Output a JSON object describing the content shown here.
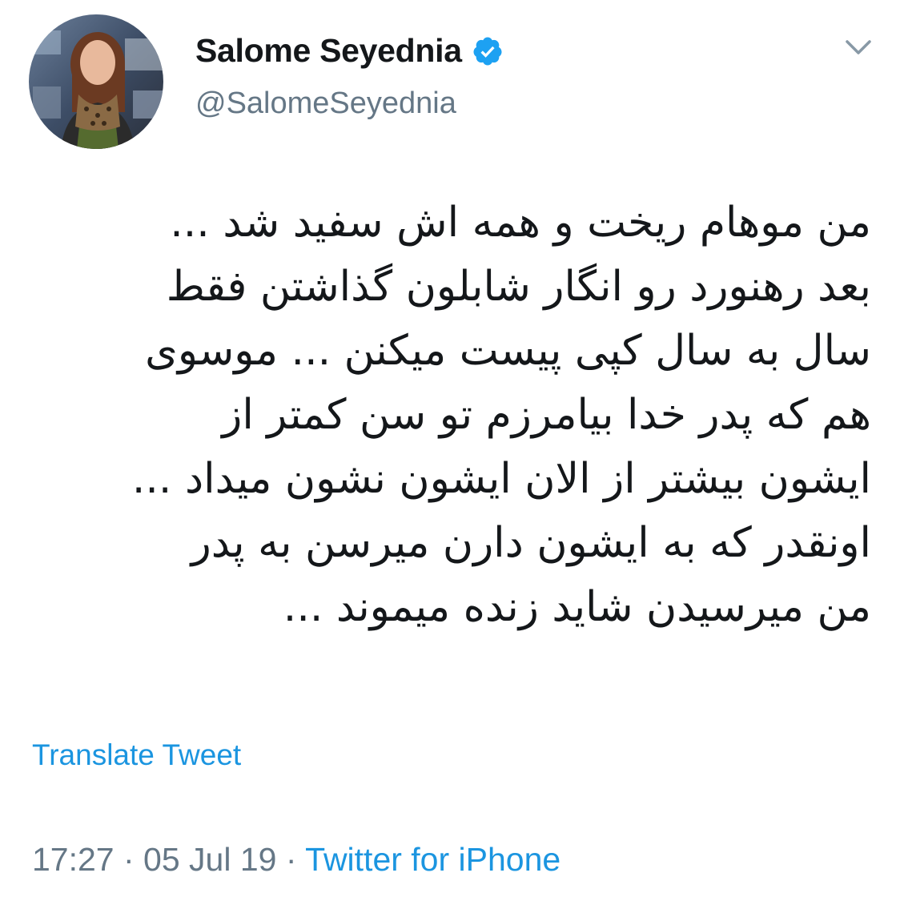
{
  "user": {
    "display_name": "Salome Seyednia",
    "handle": "@SalomeSeyednia",
    "verified": true,
    "avatar_icon": "profile-photo"
  },
  "tweet": {
    "lines": [
      "من موهام ریخت و همه اش سفید شد ...",
      "بعد رهنورد رو انگار شابلون گذاشتن فقط",
      "سال به سال کپی پیست میکنن ... موسوی",
      "هم که پدر خدا بیامرزم تو سن کمتر از",
      "ایشون بیشتر از الان ایشون نشون میداد ...",
      "اونقدر که به ایشون دارن میرسن  به پدر",
      "من میرسیدن شاید زنده میموند ..."
    ],
    "translate_label": "Translate Tweet"
  },
  "meta": {
    "time": "17:27",
    "separator1": " · ",
    "date": "05 Jul 19",
    "separator2": " · ",
    "source": "Twitter for iPhone"
  },
  "icons": {
    "verified": "verified-badge-icon",
    "menu": "chevron-down-icon"
  },
  "colors": {
    "link": "#1b95e0",
    "muted": "#657786",
    "text": "#14171a",
    "verified": "#1da1f2"
  }
}
